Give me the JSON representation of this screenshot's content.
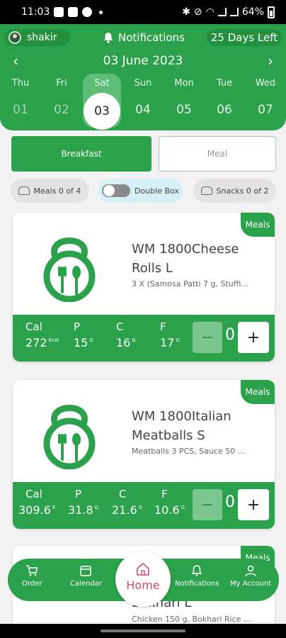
{
  "status_bar": {
    "time": "11:03",
    "battery": "64%"
  },
  "header": {
    "user_name": "shakir",
    "notifications_label": "Notifications",
    "days_left": "25 Days Left",
    "current_date": "03 June 2023"
  },
  "week": [
    {
      "name": "Thu",
      "num": "01",
      "state": "past"
    },
    {
      "name": "Fri",
      "num": "02",
      "state": "past"
    },
    {
      "name": "Sat",
      "num": "03",
      "state": "selected"
    },
    {
      "name": "Sun",
      "num": "04",
      "state": "future"
    },
    {
      "name": "Mon",
      "num": "05",
      "state": "future"
    },
    {
      "name": "Tue",
      "num": "06",
      "state": "future"
    },
    {
      "name": "Wed",
      "num": "07",
      "state": "future"
    }
  ],
  "meal_tabs": {
    "breakfast": "Breakfast",
    "meal": "Meal"
  },
  "chips": {
    "meals": "Meals 0 of 4",
    "double_box": "Double Box",
    "snacks": "Snacks 0 of 2"
  },
  "cards": [
    {
      "badge": "Meals",
      "name": "WM 1800Cheese Rolls L",
      "desc": "3 X (Samosa Patti 7 g, Stuffi...",
      "cal_label": "Cal",
      "cal": "272",
      "cal_unit": "Kcal",
      "p_label": "P",
      "p": "15",
      "p_unit": "G",
      "c_label": "C",
      "c": "16",
      "c_unit": "G",
      "f_label": "F",
      "f": "17",
      "f_unit": "G",
      "qty": "0"
    },
    {
      "badge": "Meals",
      "name": "WM 1800Italian Meatballs S",
      "desc": "Meatballs 3 PCS, Sauce 50 ...",
      "cal_label": "Cal",
      "cal": "309.6",
      "cal_unit": "K",
      "p_label": "P",
      "p": "31.8",
      "p_unit": "G",
      "c_label": "C",
      "c": "21.6",
      "c_unit": "G",
      "f_label": "F",
      "f": "10.6",
      "f_unit": "G",
      "qty": "0"
    },
    {
      "badge": "Meals",
      "name": "Bokhari L",
      "desc": "Chicken 150 g, Bokhari Rice ..."
    }
  ],
  "stepper": {
    "minus": "−",
    "plus": "+"
  },
  "bottom_nav": {
    "order": "Order",
    "calendar": "Calendar",
    "home": "Home",
    "notifications": "Notifications",
    "account": "My Account"
  },
  "colors": {
    "primary": "#2aa14a",
    "home_accent": "#d44d6d"
  }
}
